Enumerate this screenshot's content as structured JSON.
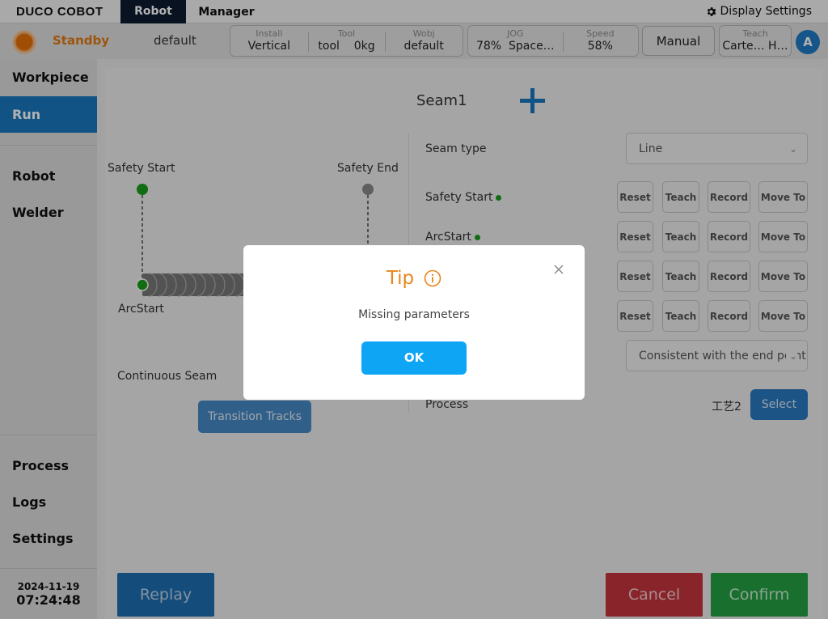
{
  "topbar": {
    "logo": "DUCO COBOT",
    "tabs": [
      {
        "label": "Robot",
        "active": true
      },
      {
        "label": "Manager",
        "active": false
      }
    ],
    "display_settings_label": "Display Settings",
    "display_settings_icon": "gear-icon"
  },
  "statusbar": {
    "state": "Standby",
    "state_color": "#e07a10",
    "program": "default",
    "install": {
      "label": "Install",
      "value": "Vertical"
    },
    "tool": {
      "label": "Tool",
      "name": "tool",
      "weight": "0kg"
    },
    "wobj": {
      "label": "Wobj",
      "value": "default"
    },
    "jog": {
      "label": "JOG",
      "percent": "78%",
      "mode": "Space…"
    },
    "speed": {
      "label": "Speed",
      "value": "58%"
    },
    "manual_label": "Manual",
    "teach": {
      "label": "Teach",
      "value": "Carte… H…"
    },
    "avatar_letter": "A"
  },
  "sidebar": {
    "items": [
      {
        "label": "Workpiece",
        "active": false
      },
      {
        "label": "Run",
        "active": true
      },
      {
        "label": "Robot",
        "active": false
      },
      {
        "label": "Welder",
        "active": false
      },
      {
        "label": "Process",
        "active": false
      },
      {
        "label": "Logs",
        "active": false
      },
      {
        "label": "Settings",
        "active": false
      }
    ],
    "date": "2024-11-19",
    "time": "07:24:48"
  },
  "seam": {
    "title": "Seam1",
    "diagram": {
      "safety_start": "Safety Start",
      "safety_end": "Safety End",
      "arc_start": "ArcStart"
    },
    "continuous_seam_label": "Continuous Seam",
    "transition_tracks_label": "Transition Tracks",
    "seam_type_label": "Seam type",
    "seam_type_value": "Line",
    "rows": [
      {
        "label": "Safety Start"
      },
      {
        "label": "ArcStart"
      },
      {
        "label": ""
      },
      {
        "label": ""
      }
    ],
    "buttons": {
      "reset": "Reset",
      "teach": "Teach",
      "record": "Record",
      "move_to": "Move To"
    },
    "end_option_value": "Consistent with the end point",
    "process_label": "Process",
    "process_value": "工艺2",
    "select_label": "Select"
  },
  "footer": {
    "replay": "Replay",
    "cancel": "Cancel",
    "confirm": "Confirm"
  },
  "dialog": {
    "title": "Tip",
    "message": "Missing parameters",
    "ok_label": "OK",
    "accent": "#e8861a",
    "ok_color": "#0ea5f5"
  }
}
